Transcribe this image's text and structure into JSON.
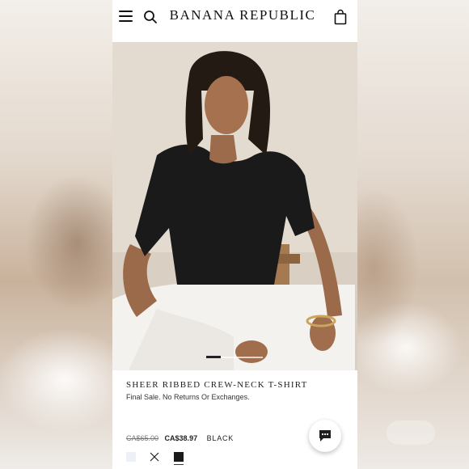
{
  "header": {
    "menu_icon": "hamburger-menu-icon",
    "search_icon": "search-icon",
    "brand": "BANANA REPUBLIC",
    "bag_icon": "shopping-bag-icon"
  },
  "hero": {
    "pager_active": 1,
    "pager_total": 4
  },
  "product": {
    "title": "SHEER RIBBED CREW-NECK T-SHIRT",
    "note": "Final Sale. No Returns Or Exchanges.",
    "price_original": "CA$65.00",
    "price_sale": "CA$38.97",
    "color": "BLACK"
  },
  "swatches": [
    {
      "name": "light-lavender",
      "color": "#eef0f8"
    },
    {
      "name": "unavailable",
      "icon": "x-icon"
    },
    {
      "name": "black",
      "color": "#1a1a1a",
      "selected": true
    }
  ],
  "chat": {
    "icon": "chat-bubble-icon"
  },
  "colors": {
    "text": "#222222",
    "background": "#ffffff",
    "shirt": "#1a1a1a"
  }
}
